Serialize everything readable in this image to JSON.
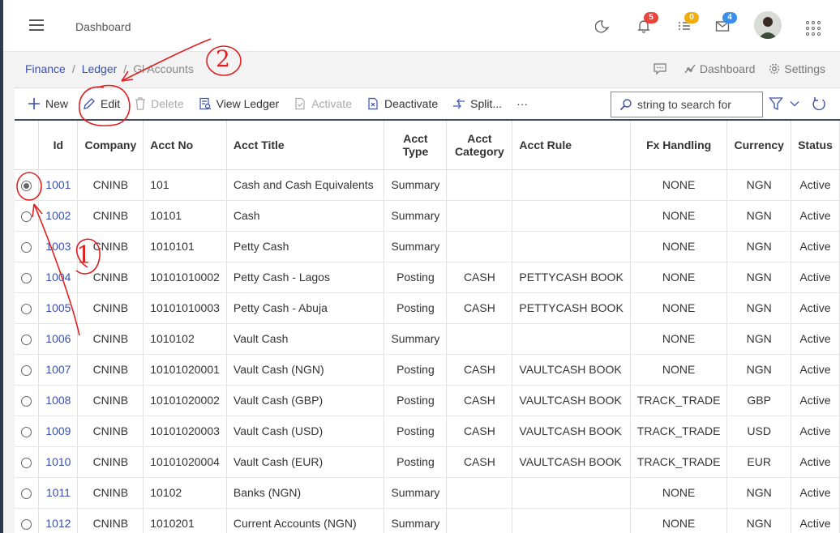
{
  "header": {
    "page_title": "Dashboard",
    "notifications_count": "5",
    "tasks_count": "0",
    "messages_count": "4",
    "colors": {
      "notif": "#e8453c",
      "tasks": "#f0ad10",
      "messages": "#3b8eea"
    }
  },
  "breadcrumb": {
    "finance": "Finance",
    "ledger": "Ledger",
    "current": "Gl Accounts"
  },
  "right_links": {
    "dashboard": "Dashboard",
    "settings": "Settings"
  },
  "toolbar": {
    "new": "New",
    "edit": "Edit",
    "delete": "Delete",
    "view_ledger": "View Ledger",
    "activate": "Activate",
    "deactivate": "Deactivate",
    "split": "Split...",
    "more": "···",
    "search_placeholder": "string to search for"
  },
  "table": {
    "headers": {
      "id": "Id",
      "company": "Company",
      "acct_no": "Acct No",
      "acct_title": "Acct Title",
      "acct_type_1": "Acct",
      "acct_type_2": "Type",
      "acct_category_1": "Acct",
      "acct_category_2": "Category",
      "acct_rule": "Acct Rule",
      "fx_handling": "Fx Handling",
      "currency": "Currency",
      "status": "Status"
    },
    "rows": [
      {
        "selected": true,
        "id": "1001",
        "company": "CNINB",
        "acct_no": "101",
        "title": "Cash and Cash Equivalents",
        "type": "Summary",
        "category": "",
        "rule": "",
        "fx": "NONE",
        "currency": "NGN",
        "status": "Active"
      },
      {
        "selected": false,
        "id": "1002",
        "company": "CNINB",
        "acct_no": "10101",
        "title": "Cash",
        "type": "Summary",
        "category": "",
        "rule": "",
        "fx": "NONE",
        "currency": "NGN",
        "status": "Active"
      },
      {
        "selected": false,
        "id": "1003",
        "company": "CNINB",
        "acct_no": "1010101",
        "title": "Petty Cash",
        "type": "Summary",
        "category": "",
        "rule": "",
        "fx": "NONE",
        "currency": "NGN",
        "status": "Active"
      },
      {
        "selected": false,
        "id": "1004",
        "company": "CNINB",
        "acct_no": "10101010002",
        "title": "Petty Cash - Lagos",
        "type": "Posting",
        "category": "CASH",
        "rule": "PETTYCASH BOOK",
        "fx": "NONE",
        "currency": "NGN",
        "status": "Active"
      },
      {
        "selected": false,
        "id": "1005",
        "company": "CNINB",
        "acct_no": "10101010003",
        "title": "Petty Cash - Abuja",
        "type": "Posting",
        "category": "CASH",
        "rule": "PETTYCASH BOOK",
        "fx": "NONE",
        "currency": "NGN",
        "status": "Active"
      },
      {
        "selected": false,
        "id": "1006",
        "company": "CNINB",
        "acct_no": "1010102",
        "title": "Vault Cash",
        "type": "Summary",
        "category": "",
        "rule": "",
        "fx": "NONE",
        "currency": "NGN",
        "status": "Active"
      },
      {
        "selected": false,
        "id": "1007",
        "company": "CNINB",
        "acct_no": "10101020001",
        "title": "Vault Cash (NGN)",
        "type": "Posting",
        "category": "CASH",
        "rule": "VAULTCASH BOOK",
        "fx": "NONE",
        "currency": "NGN",
        "status": "Active"
      },
      {
        "selected": false,
        "id": "1008",
        "company": "CNINB",
        "acct_no": "10101020002",
        "title": "Vault Cash (GBP)",
        "type": "Posting",
        "category": "CASH",
        "rule": "VAULTCASH BOOK",
        "fx": "TRACK_TRADE",
        "currency": "GBP",
        "status": "Active"
      },
      {
        "selected": false,
        "id": "1009",
        "company": "CNINB",
        "acct_no": "10101020003",
        "title": "Vault Cash (USD)",
        "type": "Posting",
        "category": "CASH",
        "rule": "VAULTCASH BOOK",
        "fx": "TRACK_TRADE",
        "currency": "USD",
        "status": "Active"
      },
      {
        "selected": false,
        "id": "1010",
        "company": "CNINB",
        "acct_no": "10101020004",
        "title": "Vault Cash (EUR)",
        "type": "Posting",
        "category": "CASH",
        "rule": "VAULTCASH BOOK",
        "fx": "TRACK_TRADE",
        "currency": "EUR",
        "status": "Active"
      },
      {
        "selected": false,
        "id": "1011",
        "company": "CNINB",
        "acct_no": "10102",
        "title": "Banks (NGN)",
        "type": "Summary",
        "category": "",
        "rule": "",
        "fx": "NONE",
        "currency": "NGN",
        "status": "Active"
      },
      {
        "selected": false,
        "id": "1012",
        "company": "CNINB",
        "acct_no": "1010201",
        "title": "Current Accounts (NGN)",
        "type": "Summary",
        "category": "",
        "rule": "",
        "fx": "NONE",
        "currency": "NGN",
        "status": "Active"
      }
    ]
  },
  "annotations": {
    "one": "1",
    "two": "2",
    "color": "#e02020"
  }
}
